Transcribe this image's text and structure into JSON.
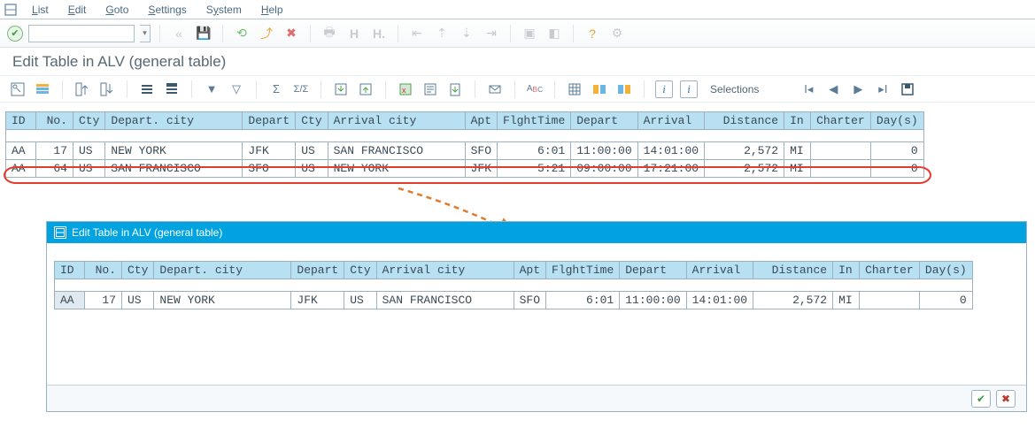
{
  "menu": {
    "list": "List",
    "edit": "Edit",
    "goto": "Goto",
    "settings": "Settings",
    "system": "System",
    "help": "Help"
  },
  "title": "Edit Table in ALV (general table)",
  "app_toolbar": {
    "selections": "Selections"
  },
  "columns": {
    "id": "ID",
    "no": "No.",
    "cty1": "Cty",
    "depart_city": "Depart. city",
    "depart": "Depart",
    "cty2": "Cty",
    "arrival_city": "Arrival city",
    "apt": "Apt",
    "flight_time": "FlghtTime",
    "depart_t": "Depart",
    "arrival_t": "Arrival",
    "distance": "Distance",
    "in": "In",
    "charter": "Charter",
    "days": "Day(s)"
  },
  "rows": [
    {
      "id": "AA",
      "no": "17",
      "cty1": "US",
      "depart_city": "NEW YORK",
      "depart": "JFK",
      "cty2": "US",
      "arrival_city": "SAN FRANCISCO",
      "apt": "SFO",
      "flight_time": "6:01",
      "depart_t": "11:00:00",
      "arrival_t": "14:01:00",
      "distance": "2,572",
      "in": "MI",
      "charter": "",
      "days": "0"
    },
    {
      "id": "AA",
      "no": "64",
      "cty1": "US",
      "depart_city": "SAN FRANCISCO",
      "depart": "SFO",
      "cty2": "US",
      "arrival_city": "NEW YORK",
      "apt": "JFK",
      "flight_time": "5:21",
      "depart_t": "09:00:00",
      "arrival_t": "17:21:00",
      "distance": "2,572",
      "in": "MI",
      "charter": "",
      "days": "0"
    }
  ],
  "popup": {
    "title": "Edit Table in ALV (general table)",
    "row": {
      "id": "AA",
      "no": "17",
      "cty1": "US",
      "depart_city": "NEW YORK",
      "depart": "JFK",
      "cty2": "US",
      "arrival_city": "SAN FRANCISCO",
      "apt": "SFO",
      "flight_time": "6:01",
      "depart_t": "11:00:00",
      "arrival_t": "14:01:00",
      "distance": "2,572",
      "in": "MI",
      "charter": "",
      "days": "0"
    }
  }
}
